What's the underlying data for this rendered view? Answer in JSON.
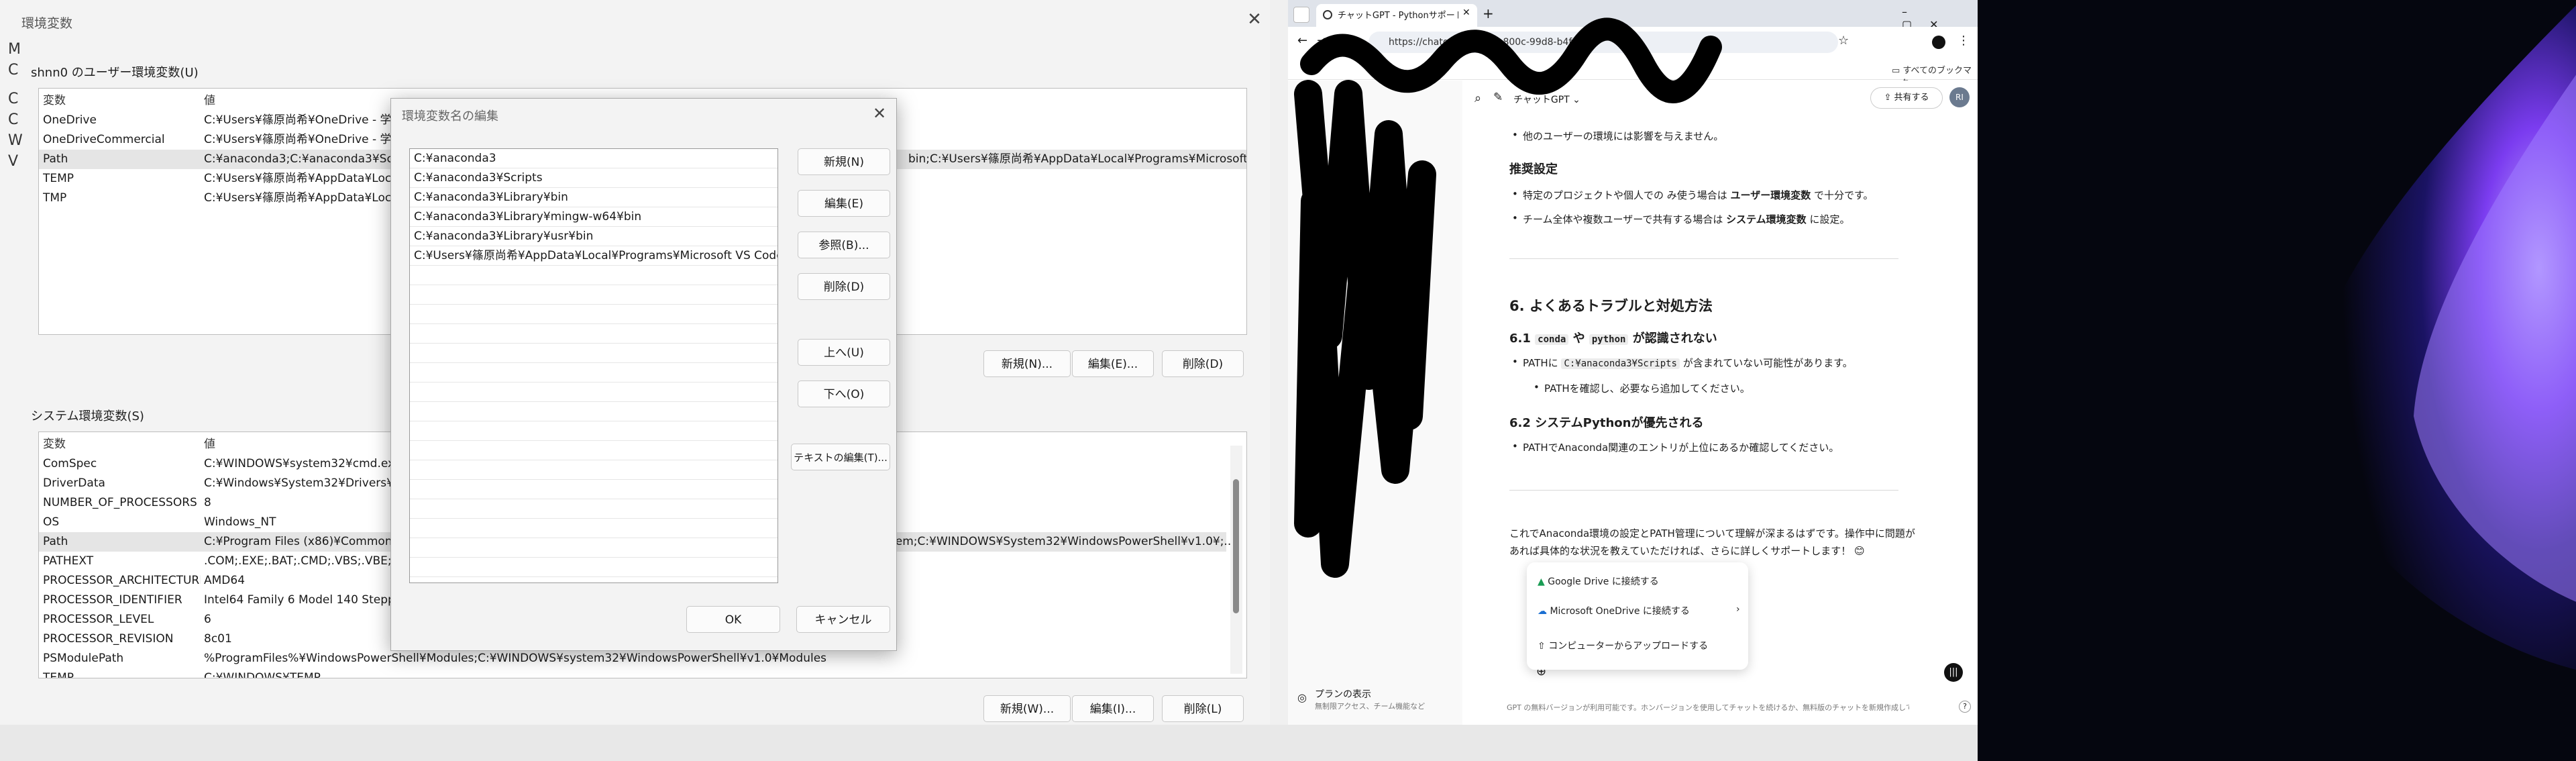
{
  "env_window": {
    "title": "環境変数",
    "left_strip": [
      "M",
      "C",
      "C",
      "C",
      "W",
      "V"
    ],
    "user_section_label": "shnn0 のユーザー環境変数(U)",
    "columns": {
      "name": "変数",
      "value": "値"
    },
    "user_vars": [
      {
        "name": "OneDrive",
        "value": "C:¥Users¥篠原尚希¥OneDrive - 学校"
      },
      {
        "name": "OneDriveCommercial",
        "value": "C:¥Users¥篠原尚希¥OneDrive - 学校"
      },
      {
        "name": "Path",
        "value": "C:¥anaconda3;C:¥anaconda3¥Scripts",
        "value_tail": "bin;C:¥Users¥篠原尚希¥AppData¥Local¥Programs¥Microsoft ..."
      },
      {
        "name": "TEMP",
        "value": "C:¥Users¥篠原尚希¥AppData¥Local"
      },
      {
        "name": "TMP",
        "value": "C:¥Users¥篠原尚希¥AppData¥Local"
      }
    ],
    "user_buttons": {
      "new": "新規(N)...",
      "edit": "編集(E)...",
      "delete": "削除(D)"
    },
    "system_section_label": "システム環境変数(S)",
    "system_vars": [
      {
        "name": "ComSpec",
        "value": "C:¥WINDOWS¥system32¥cmd.exe"
      },
      {
        "name": "DriverData",
        "value": "C:¥Windows¥System32¥Drivers¥Dr"
      },
      {
        "name": "NUMBER_OF_PROCESSORS",
        "value": "8"
      },
      {
        "name": "OS",
        "value": "Windows_NT"
      },
      {
        "name": "Path",
        "value": "C:¥Program Files (x86)¥Common Fi",
        "value_tail": "bem;C:¥WINDOWS¥System32¥WindowsPowerShell¥v1.0¥;..."
      },
      {
        "name": "PATHEXT",
        "value": ".COM;.EXE;.BAT;.CMD;.VBS;.VBE;.JS;.J"
      },
      {
        "name": "PROCESSOR_ARCHITECTURE",
        "value": "AMD64"
      },
      {
        "name": "PROCESSOR_IDENTIFIER",
        "value": "Intel64 Family 6 Model 140 Steppin"
      },
      {
        "name": "PROCESSOR_LEVEL",
        "value": "6"
      },
      {
        "name": "PROCESSOR_REVISION",
        "value": "8c01"
      },
      {
        "name": "PSModulePath",
        "value": "%ProgramFiles%¥WindowsPowerShell¥Modules;C:¥WINDOWS¥system32¥WindowsPowerShell¥v1.0¥Modules"
      },
      {
        "name": "TEMP",
        "value": "C:¥WINDOWS¥TEMP"
      }
    ],
    "system_buttons": {
      "new": "新規(W)...",
      "edit": "編集(I)...",
      "delete": "削除(L)"
    }
  },
  "edit_dialog": {
    "title": "環境変数名の編集",
    "paths": [
      "C:¥anaconda3",
      "C:¥anaconda3¥Scripts",
      "C:¥anaconda3¥Library¥bin",
      "C:¥anaconda3¥Library¥mingw-w64¥bin",
      "C:¥anaconda3¥Library¥usr¥bin",
      "C:¥Users¥篠原尚希¥AppData¥Local¥Programs¥Microsoft VS Code..."
    ],
    "buttons": {
      "new": "新規(N)",
      "edit": "編集(E)",
      "browse": "参照(B)...",
      "delete": "削除(D)",
      "up": "上へ(U)",
      "down": "下へ(O)",
      "edit_text": "テキストの編集(T)...",
      "ok": "OK",
      "cancel": "キャンセル"
    }
  },
  "chrome": {
    "tab_title": "チャットGPT - Pythonサポート提供",
    "url_fragment": "https://chatgpt.com/...4-800c-99d8-b4f958...",
    "bookmarks_label": "すべてのブックマーク",
    "model_label": "チャットGPT",
    "share_label": "共有する",
    "avatar_initials": "RI",
    "sidebar_footer_title": "プランの表示",
    "sidebar_footer_sub": "無制限アクセス、チーム機能など",
    "content": {
      "bullet_top": "他のユーザーの環境には影響を与えません。",
      "recommend_heading": "推奨設定",
      "recommend_1_pre": "特定のプロジェクトや個人での み使う場合は ",
      "recommend_1_bold": "ユーザー環境変数",
      "recommend_1_post": " で十分です。",
      "recommend_2_pre": "チーム全体や複数ユーザーで共有する場合は ",
      "recommend_2_bold": "システム環境変数",
      "recommend_2_post": " に設定。",
      "section6_heading": "6. よくあるトラブルと対処方法",
      "s61_prefix": "6.1 ",
      "s61_code1": "conda",
      "s61_mid": " や ",
      "s61_code2": "python",
      "s61_suffix": " が認識されない",
      "s61_bullet_pre": "PATHに ",
      "s61_bullet_code": "C:¥anaconda3¥Scripts",
      "s61_bullet_post": " が含まれていない可能性があります。",
      "s61_sub": "PATHを確認し、必要なら追加してください。",
      "s62_heading": "6.2 システムPythonが優先される",
      "s62_bullet": "PATHでAnaconda関連のエントリが上位にあるか確認してください。",
      "closing_1": "これでAnaconda環境の設定とPATH管理について理解が深まるはずです。操作中に問題が",
      "closing_2": "あれば具体的な状況を教えていただければ、さらに詳しくサポートします！ 😊"
    },
    "upload_menu": {
      "google_drive": "Google Drive に接続する",
      "onedrive": "Microsoft OneDrive に接続する",
      "computer": "コンピューターからアップロードする"
    },
    "footer_note": "GPT の無料バージョンが利用可能です。ホンバージョンを使用してチャットを続けるか、無料版のチャットを新規作成してください。"
  },
  "colors": {
    "dialog_bg": "#f3f3f3",
    "selection": "#e5e5e5",
    "chrome_tabstrip": "#dfe3ea",
    "desktop_bg": "#05060f",
    "desktop_glow": "#7b3cf0"
  }
}
